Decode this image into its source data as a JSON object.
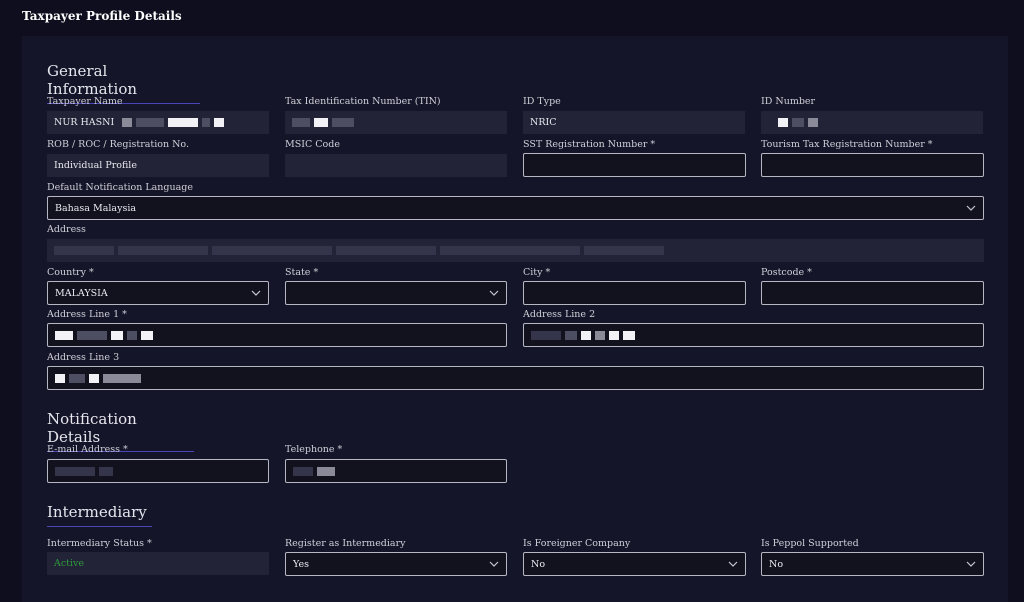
{
  "page_title": "Taxpayer Profile Details",
  "general": {
    "title": "General Information",
    "taxpayer_name_label": "Taxpayer Name",
    "taxpayer_name_value": "NUR HASNI",
    "tin_label": "Tax Identification Number (TIN)",
    "id_type_label": "ID Type",
    "id_type_value": "NRIC",
    "id_number_label": "ID Number",
    "rob_label": "ROB / ROC / Registration No.",
    "rob_value": "Individual Profile",
    "msic_label": "MSIC Code",
    "sst_label": "SST Registration Number *",
    "tourism_label": "Tourism Tax Registration Number *",
    "lang_label": "Default Notification Language",
    "lang_value": "Bahasa Malaysia",
    "address_label": "Address",
    "country_label": "Country *",
    "country_value": "MALAYSIA",
    "state_label": "State *",
    "city_label": "City *",
    "postcode_label": "Postcode *",
    "addr1_label": "Address Line 1 *",
    "addr2_label": "Address Line 2",
    "addr3_label": "Address Line 3"
  },
  "notification": {
    "title": "Notification Details",
    "email_label": "E-mail Address *",
    "phone_label": "Telephone *"
  },
  "intermediary": {
    "title": "Intermediary",
    "status_label": "Intermediary Status *",
    "status_value": "Active",
    "register_label": "Register as Intermediary",
    "register_value": "Yes",
    "foreign_label": "Is Foreigner Company",
    "foreign_value": "No",
    "peppol_label": "Is Peppol Supported",
    "peppol_value": "No"
  },
  "colors": {
    "background": "#0e0e1e",
    "card": "#15152a",
    "accent_underline": "#4b45b8",
    "active_status": "#2e9a3a"
  },
  "icons": {
    "select_chevron": "chevron-down-icon"
  }
}
